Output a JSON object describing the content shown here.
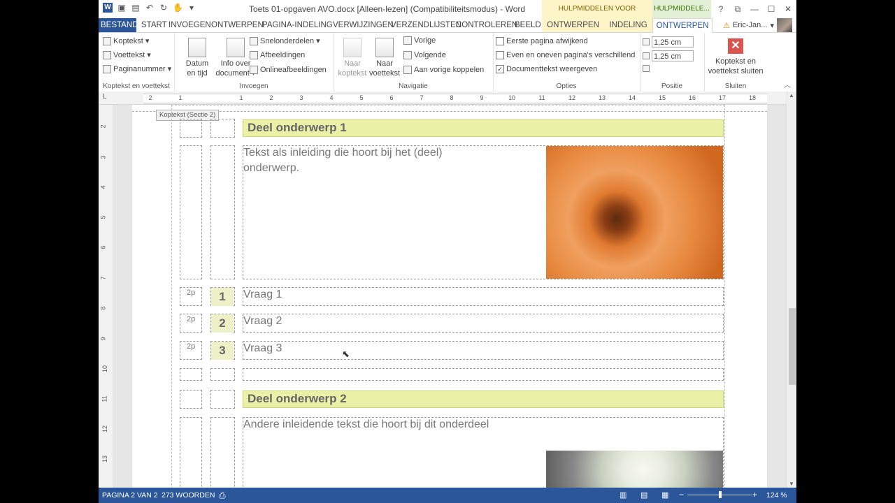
{
  "window": {
    "title": "Toets 01-opgaven AVO.docx [Alleen-lezen] (Compatibiliteitsmodus) - Word",
    "context_tab_tables": "HULPMIDDELEN VOOR TABELLEN",
    "context_tab_header": "HULPMIDDELE..."
  },
  "tabs": {
    "file": "BESTAND",
    "start": "START",
    "insert": "INVOEGEN",
    "design": "ONTWERPEN",
    "layout": "PAGINA-INDELING",
    "references": "VERWIJZINGEN",
    "mailings": "VERZENDLIJSTEN",
    "review": "CONTROLEREN",
    "view": "BEELD",
    "table_design": "ONTWERPEN",
    "table_layout": "INDELING",
    "header_design": "ONTWERPEN"
  },
  "user": {
    "name": "Eric-Jan..."
  },
  "ribbon": {
    "hf": {
      "header": "Koptekst",
      "footer": "Voettekst",
      "pagenum": "Paginanummer",
      "label": "Koptekst en voettekst"
    },
    "insert": {
      "datetime_1": "Datum",
      "datetime_2": "en tijd",
      "docinfo_1": "Info over",
      "docinfo_2": "document",
      "quickparts": "Snelonderdelen",
      "pictures": "Afbeeldingen",
      "online": "Onlineafbeeldingen",
      "label": "Invoegen"
    },
    "nav": {
      "goto_header_1": "Naar",
      "goto_header_2": "koptekst",
      "goto_footer_1": "Naar",
      "goto_footer_2": "voettekst",
      "prev": "Vorige",
      "next": "Volgende",
      "link": "Aan vorige koppelen",
      "label": "Navigatie"
    },
    "options": {
      "first_page": "Eerste pagina afwijkend",
      "odd_even": "Even en oneven pagina's verschillend",
      "show_doc_text": "Documenttekst weergeven",
      "label": "Opties"
    },
    "position": {
      "header_pos": "1,25 cm",
      "footer_pos": "1,25 cm",
      "label": "Positie"
    },
    "close": {
      "line1": "Koptekst en",
      "line2": "voettekst sluiten",
      "label": "Sluiten"
    }
  },
  "document": {
    "header_tag": "Koptekst (Sectie 2)",
    "section1_title": "Deel onderwerp 1",
    "section1_intro_1": "Tekst als inleiding die hoort bij het (deel)",
    "section1_intro_2": "onderwerp.",
    "questions": [
      {
        "points": "2p",
        "num": "1",
        "text": "Vraag 1"
      },
      {
        "points": "2p",
        "num": "2",
        "text": "Vraag 2"
      },
      {
        "points": "2p",
        "num": "3",
        "text": "Vraag 3"
      }
    ],
    "section2_title": "Deel onderwerp 2",
    "section2_intro": "Andere inleidende tekst die hoort bij dit onderdeel"
  },
  "status": {
    "page": "PAGINA 2 VAN 2",
    "words": "273 WOORDEN",
    "zoom": "124 %"
  },
  "ruler": {
    "h": [
      "2",
      "1",
      "1",
      "2",
      "3",
      "4",
      "5",
      "6",
      "7",
      "8",
      "9",
      "10",
      "11",
      "12",
      "13",
      "14",
      "15",
      "16",
      "17",
      "18"
    ],
    "v": [
      "2",
      "3",
      "4",
      "5",
      "6",
      "7",
      "8",
      "9",
      "10",
      "11",
      "12",
      "13"
    ]
  }
}
